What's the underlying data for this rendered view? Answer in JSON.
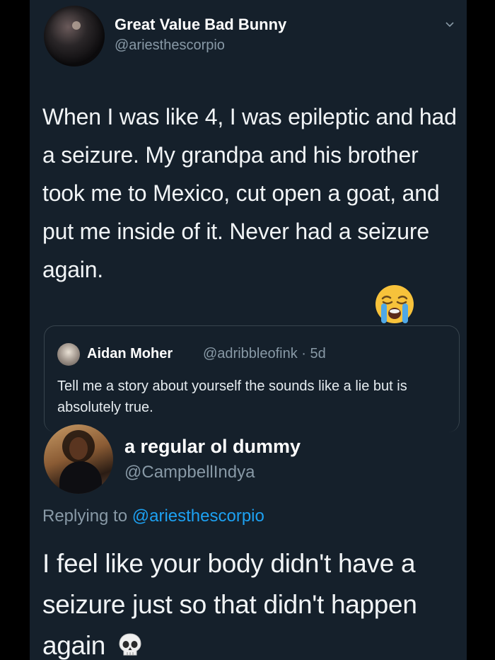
{
  "tweet": {
    "author_name": "Great Value Bad Bunny",
    "author_handle": "@ariesthescorpio",
    "text": "When I was like 4, I was epileptic and had a seizure. My grandpa and his brother took me to Mexico, cut open a goat, and put me inside of it. Never had a seizure again.",
    "emoji": "loudly-crying-face-emoji"
  },
  "quoted_tweet": {
    "author_name": "Aidan Moher",
    "author_handle": "@adribbleofink · 5d",
    "text": "Tell me a story about yourself the sounds like a lie but is absolutely true."
  },
  "reply": {
    "author_name": "a regular ol dummy",
    "author_handle": "@CampbellIndya",
    "replying_prefix": "Replying to",
    "replying_mention": "@ariesthescorpio",
    "text": "I feel like your body didn't have a seizure just so that didn't happen again",
    "emoji": "skull-emoji"
  },
  "colors": {
    "background": "#15202b",
    "secondary_text": "#8899a6",
    "link": "#1da1f2",
    "border": "#38444d"
  }
}
